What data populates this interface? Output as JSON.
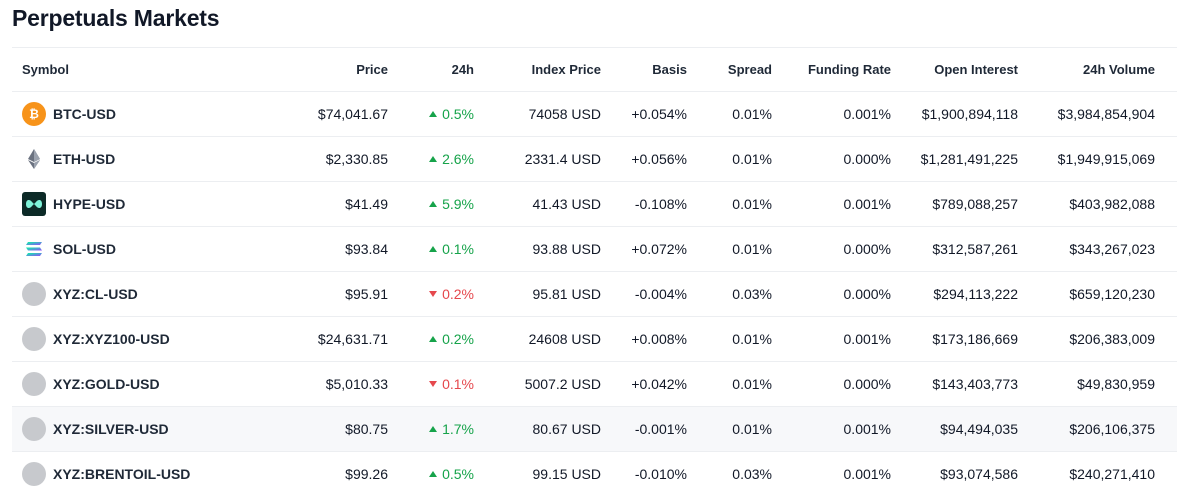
{
  "title": "Perpetuals Markets",
  "columns": {
    "symbol": "Symbol",
    "price": "Price",
    "change": "24h",
    "index_price": "Index Price",
    "basis": "Basis",
    "spread": "Spread",
    "funding_rate": "Funding Rate",
    "open_interest": "Open Interest",
    "volume": "24h Volume"
  },
  "colors": {
    "up": "#16a34a",
    "down": "#e5484d",
    "btc": "#f7931a"
  },
  "rows": [
    {
      "symbol": "BTC-USD",
      "icon": "bitcoin-icon",
      "price": "$74,041.67",
      "direction": "up",
      "change": "0.5%",
      "index_price": "74058 USD",
      "basis": "+0.054%",
      "spread": "0.01%",
      "funding_rate": "0.001%",
      "open_interest": "$1,900,894,118",
      "volume": "$3,984,854,904"
    },
    {
      "symbol": "ETH-USD",
      "icon": "ethereum-icon",
      "price": "$2,330.85",
      "direction": "up",
      "change": "2.6%",
      "index_price": "2331.4 USD",
      "basis": "+0.056%",
      "spread": "0.01%",
      "funding_rate": "0.000%",
      "open_interest": "$1,281,491,225",
      "volume": "$1,949,915,069"
    },
    {
      "symbol": "HYPE-USD",
      "icon": "hyperliquid-icon",
      "price": "$41.49",
      "direction": "up",
      "change": "5.9%",
      "index_price": "41.43 USD",
      "basis": "-0.108%",
      "spread": "0.01%",
      "funding_rate": "0.001%",
      "open_interest": "$789,088,257",
      "volume": "$403,982,088"
    },
    {
      "symbol": "SOL-USD",
      "icon": "solana-icon",
      "price": "$93.84",
      "direction": "up",
      "change": "0.1%",
      "index_price": "93.88 USD",
      "basis": "+0.072%",
      "spread": "0.01%",
      "funding_rate": "0.000%",
      "open_interest": "$312,587,261",
      "volume": "$343,267,023"
    },
    {
      "symbol": "XYZ:CL-USD",
      "icon": "placeholder-coin-icon",
      "price": "$95.91",
      "direction": "down",
      "change": "0.2%",
      "index_price": "95.81 USD",
      "basis": "-0.004%",
      "spread": "0.03%",
      "funding_rate": "0.000%",
      "open_interest": "$294,113,222",
      "volume": "$659,120,230"
    },
    {
      "symbol": "XYZ:XYZ100-USD",
      "icon": "placeholder-coin-icon",
      "price": "$24,631.71",
      "direction": "up",
      "change": "0.2%",
      "index_price": "24608 USD",
      "basis": "+0.008%",
      "spread": "0.01%",
      "funding_rate": "0.001%",
      "open_interest": "$173,186,669",
      "volume": "$206,383,009"
    },
    {
      "symbol": "XYZ:GOLD-USD",
      "icon": "placeholder-coin-icon",
      "price": "$5,010.33",
      "direction": "down",
      "change": "0.1%",
      "index_price": "5007.2 USD",
      "basis": "+0.042%",
      "spread": "0.01%",
      "funding_rate": "0.000%",
      "open_interest": "$143,403,773",
      "volume": "$49,830,959"
    },
    {
      "symbol": "XYZ:SILVER-USD",
      "icon": "placeholder-coin-icon",
      "price": "$80.75",
      "direction": "up",
      "change": "1.7%",
      "index_price": "80.67 USD",
      "basis": "-0.001%",
      "spread": "0.01%",
      "funding_rate": "0.001%",
      "open_interest": "$94,494,035",
      "volume": "$206,106,375"
    },
    {
      "symbol": "XYZ:BRENTOIL-USD",
      "icon": "placeholder-coin-icon",
      "price": "$99.26",
      "direction": "up",
      "change": "0.5%",
      "index_price": "99.15 USD",
      "basis": "-0.010%",
      "spread": "0.03%",
      "funding_rate": "0.001%",
      "open_interest": "$93,074,586",
      "volume": "$240,271,410"
    }
  ]
}
